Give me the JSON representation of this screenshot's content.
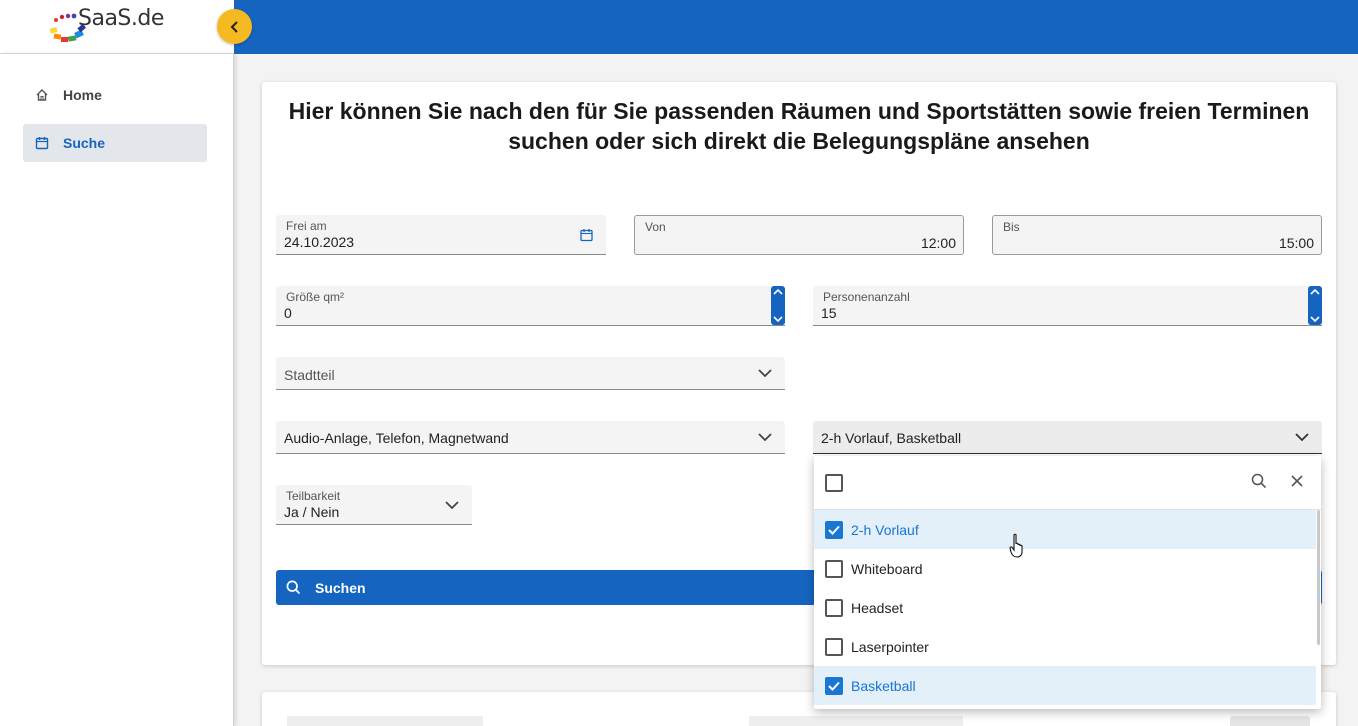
{
  "brand": {
    "logo_text": "SaaS.de"
  },
  "sidebar": {
    "items": [
      {
        "label": "Home",
        "icon": "home-icon"
      },
      {
        "label": "Suche",
        "icon": "calendar-icon"
      }
    ]
  },
  "main": {
    "headline_line1": "Hier können Sie nach den für Sie passenden Räumen und Sportstätten sowie freien Terminen",
    "headline_line2": "suchen oder sich direkt die Belegungspläne ansehen",
    "fields": {
      "frei_am": {
        "label": "Frei am",
        "value": "24.10.2023"
      },
      "von": {
        "label": "Von",
        "value": "12:00"
      },
      "bis": {
        "label": "Bis",
        "value": "15:00"
      },
      "groesse": {
        "label": "Größe qm²",
        "value": "0"
      },
      "personen": {
        "label": "Personenanzahl",
        "value": "15"
      },
      "stadtteil": {
        "placeholder": "Stadtteil"
      },
      "ausstattung": {
        "value": "Audio-Anlage, Telefon, Magnetwand"
      },
      "sportart": {
        "value": "2-h Vorlauf, Basketball"
      },
      "teilbarkeit": {
        "label": "Teilbarkeit",
        "value": "Ja / Nein"
      }
    },
    "search_button": "Suchen"
  },
  "dropdown": {
    "options": [
      {
        "label": "2-h Vorlauf",
        "checked": true
      },
      {
        "label": "Whiteboard",
        "checked": false
      },
      {
        "label": "Headset",
        "checked": false
      },
      {
        "label": "Laserpointer",
        "checked": false
      },
      {
        "label": "Basketball",
        "checked": true
      }
    ]
  },
  "colors": {
    "primary": "#1565c0",
    "accent": "#f5b921",
    "selected_bg": "#e3eff9"
  }
}
